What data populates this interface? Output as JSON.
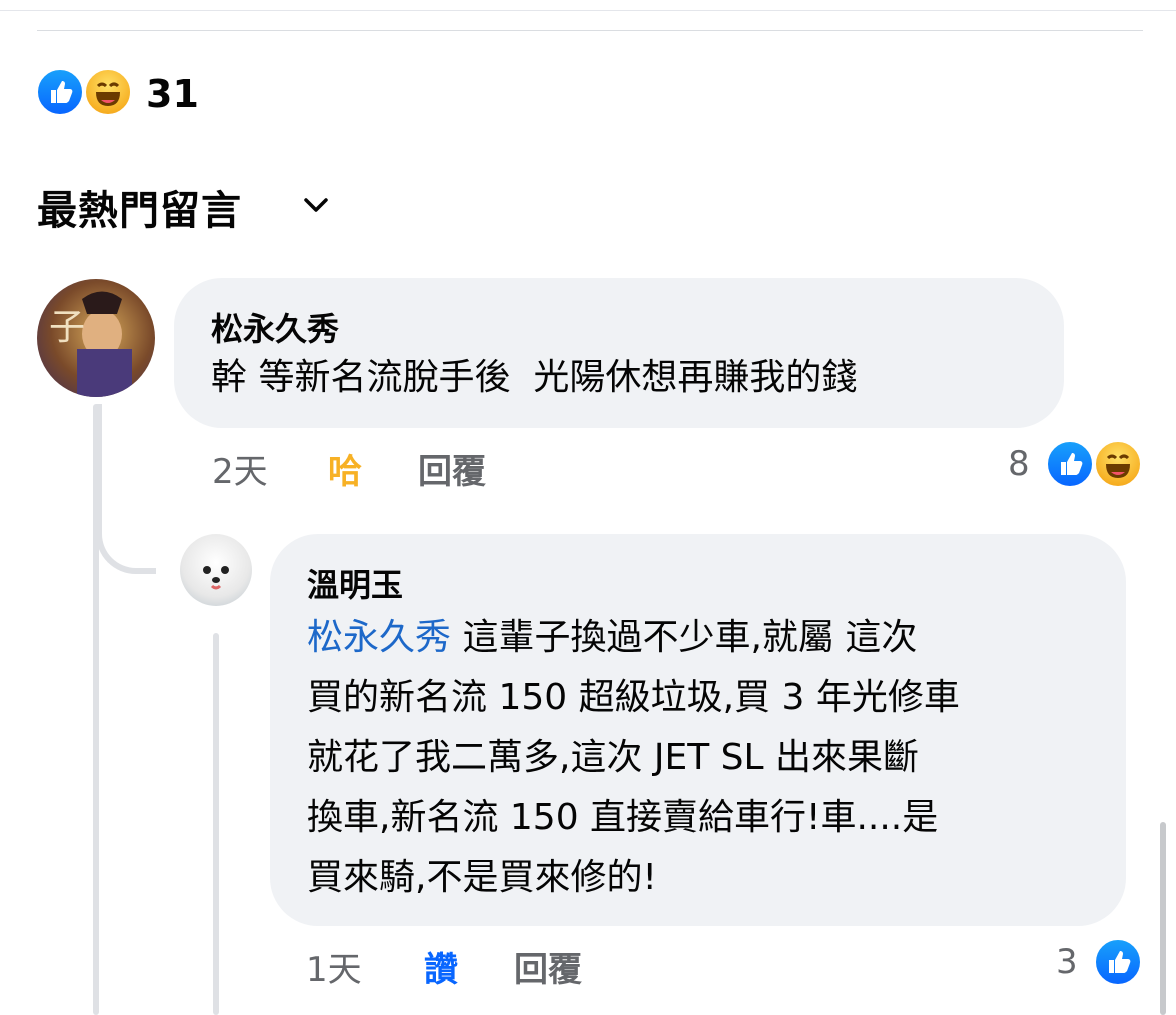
{
  "post": {
    "reaction_count": "31"
  },
  "sort": {
    "label": "最熱門留言"
  },
  "comments": [
    {
      "author": "松永久秀",
      "text": "幹 等新名流脫手後  光陽休想再賺我的錢",
      "time": "2天",
      "reaction_action": "哈",
      "reply_label": "回覆",
      "reaction_count": "8"
    },
    {
      "author": "溫明玉",
      "mention": "松永久秀",
      "lines": [
        " 這輩子換過不少車,就屬 這次",
        "買的新名流 150 超級垃圾,買 3 年光修車",
        "就花了我二萬多,這次 JET SL 出來果斷",
        "換車,新名流 150 直接賣給車行!車....是",
        "買來騎,不是買來修的!"
      ],
      "time": "1天",
      "reaction_action": "讚",
      "reply_label": "回覆",
      "reaction_count": "3"
    }
  ],
  "colors": {
    "haha_active": "#f7b125",
    "like_active": "#0866ff",
    "mention": "#1d68c9"
  }
}
